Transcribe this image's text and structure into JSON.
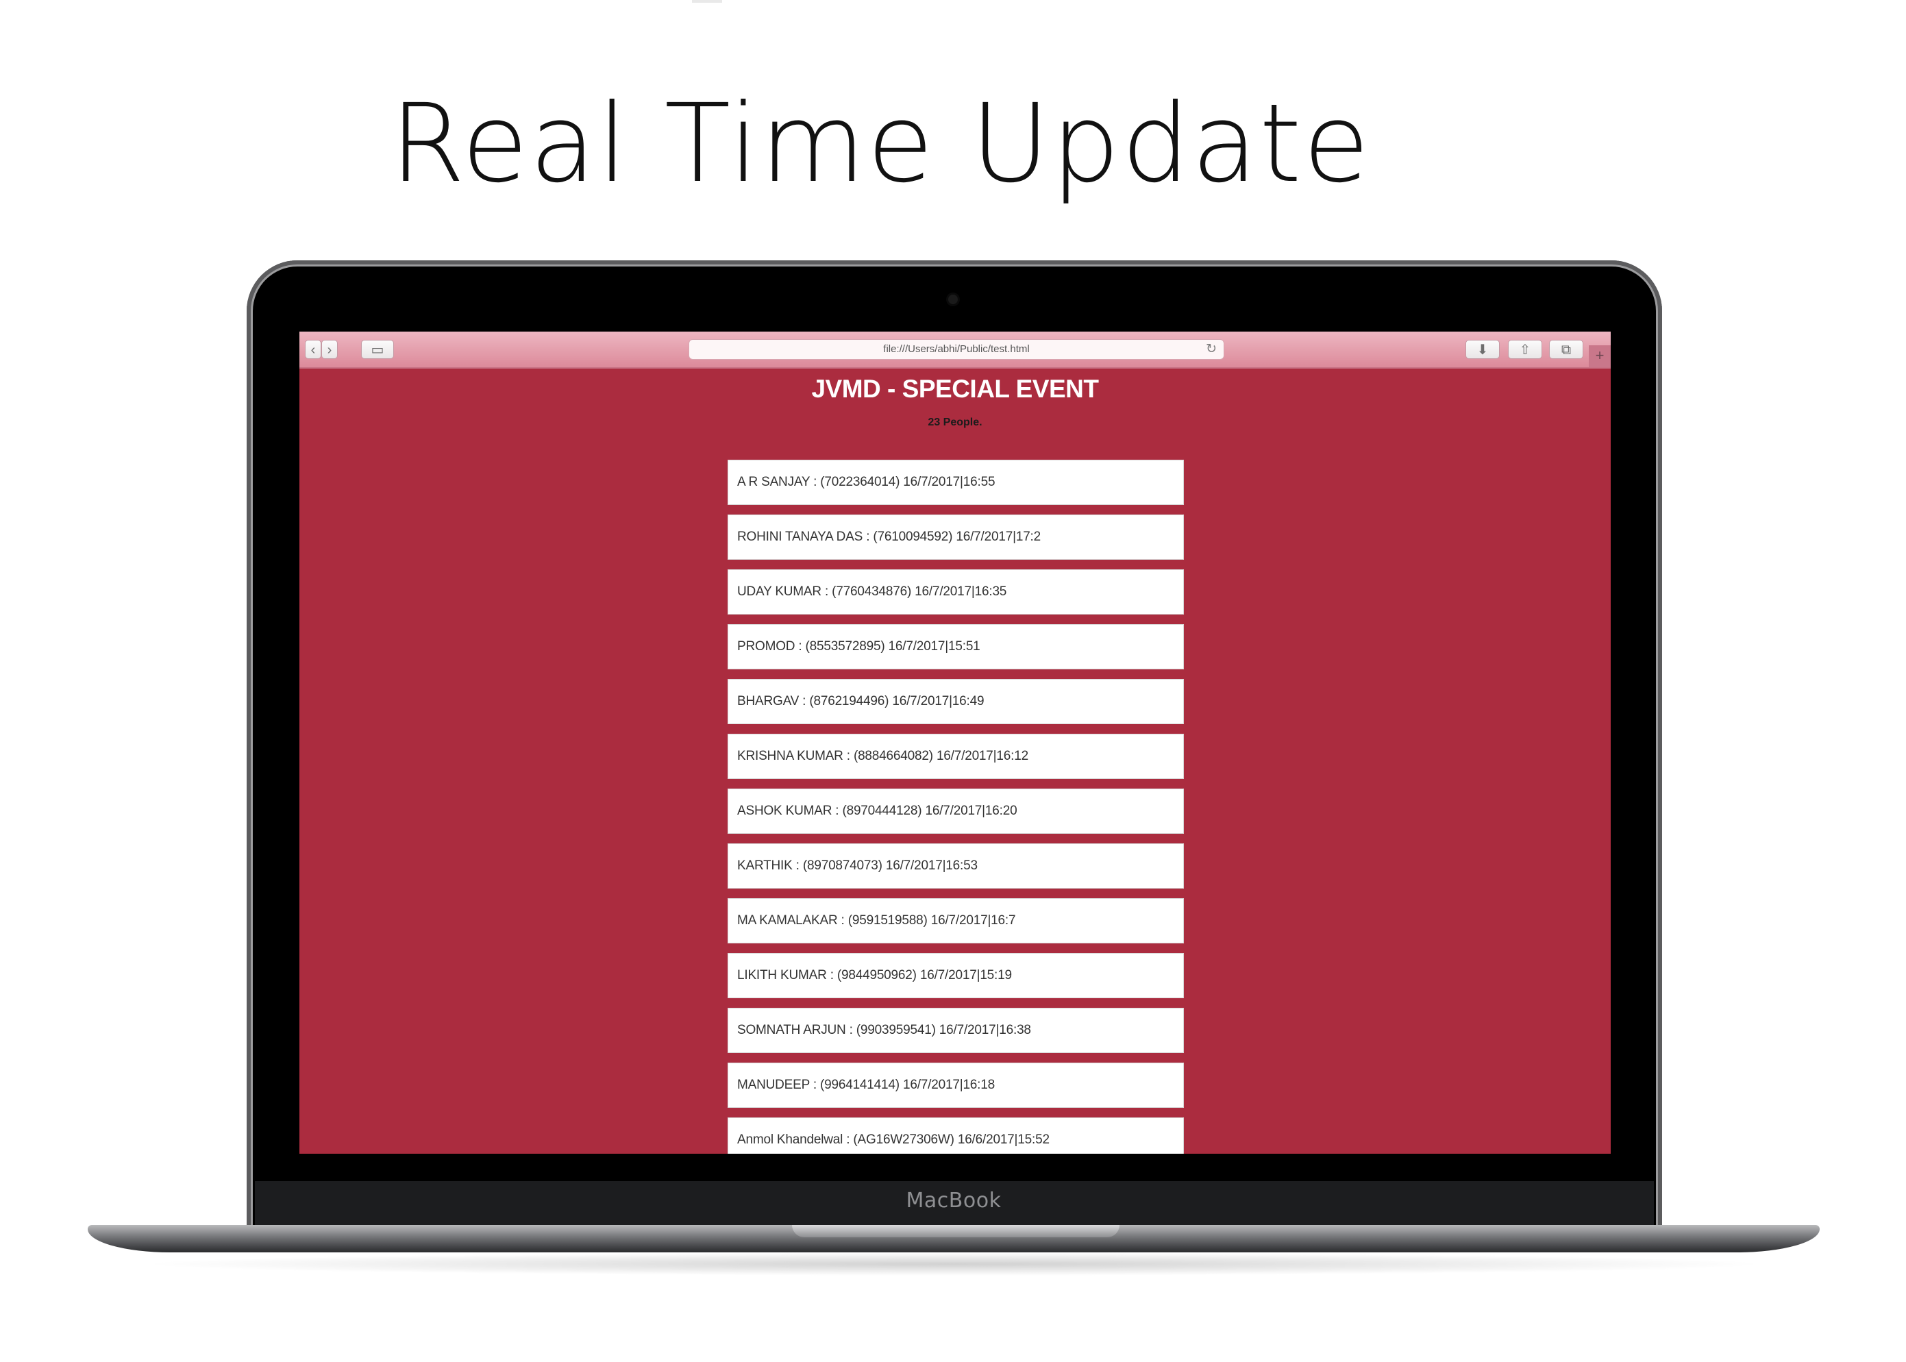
{
  "headline": "Real Time Update",
  "laptop": {
    "brand": "MacBook"
  },
  "browser": {
    "url": "file:///Users/abhi/Public/test.html",
    "back_icon": "‹",
    "forward_icon": "›",
    "sidebar_icon": "▭",
    "reload_icon": "↻",
    "download_icon": "⬇",
    "share_icon": "⇧",
    "tabs_icon": "⧉",
    "new_tab_icon": "+"
  },
  "page": {
    "title": "JVMD - SPECIAL EVENT",
    "count": "23 People.",
    "entries": [
      "A R SANJAY : (7022364014) 16/7/2017|16:55",
      "ROHINI TANAYA DAS : (7610094592) 16/7/2017|17:2",
      "UDAY KUMAR : (7760434876) 16/7/2017|16:35",
      "PROMOD : (8553572895) 16/7/2017|15:51",
      "BHARGAV : (8762194496) 16/7/2017|16:49",
      "KRISHNA KUMAR : (8884664082) 16/7/2017|16:12",
      "ASHOK KUMAR : (8970444128) 16/7/2017|16:20",
      "KARTHIK : (8970874073) 16/7/2017|16:53",
      "MA KAMALAKAR : (9591519588) 16/7/2017|16:7",
      "LIKITH KUMAR : (9844950962) 16/7/2017|15:19",
      "SOMNATH ARJUN : (9903959541) 16/7/2017|16:38",
      "MANUDEEP : (9964141414) 16/7/2017|16:18",
      "Anmol Khandelwal : (AG16W27306W) 16/6/2017|15:52"
    ]
  },
  "colors": {
    "page_background": "#ab2c3f",
    "toolbar": "#e3a0ae",
    "card": "#ffffff"
  }
}
